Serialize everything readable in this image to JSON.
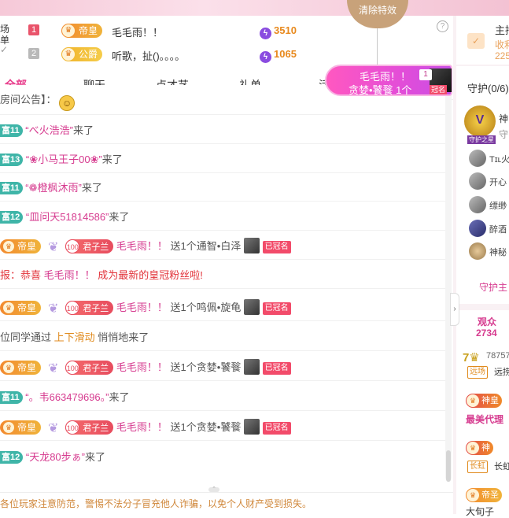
{
  "clear_effects_label": "清除特效",
  "ranking": {
    "cut_label_1": "场",
    "cut_label_2": "单",
    "cut_label_3": "✓",
    "rows": [
      {
        "rank": "1",
        "badge": "帝皇",
        "name": "毛毛雨！！",
        "coins": "3510"
      },
      {
        "rank": "2",
        "badge": "公爵",
        "name": "听歌，扯()。。。。",
        "coins": "1065"
      }
    ],
    "help_icon": "?"
  },
  "tabs": [
    "全部",
    "聊天",
    "点才艺",
    "礼单",
    "活"
  ],
  "banner": {
    "line1": "毛毛雨！！",
    "line2": "贪婪•饕餮 1个",
    "count": "1",
    "tag": "冠名"
  },
  "chat": {
    "m1": {
      "prefix": "房间公告】：",
      "emoji": "😁"
    },
    "m2": {
      "level": "富11",
      "name": "“べ火浩浩”",
      "suffix": "来了"
    },
    "m3": {
      "level": "富13",
      "name": "“❀小马王子00❀”",
      "suffix": "来了"
    },
    "m4": {
      "level": "富11",
      "name": "“❁橙枫沐雨”",
      "suffix": "来了"
    },
    "m5": {
      "level": "富12",
      "name": "“皿问天51814586”",
      "suffix": "来了"
    },
    "m6": {
      "badge": "帝皇",
      "fan_level": "100",
      "fan_name": "君子兰",
      "user": "毛毛雨！！",
      "gift": "送1个通智•白泽",
      "tag": "已冠名"
    },
    "m7": {
      "text_a": "报：恭喜 ",
      "user": "毛毛雨！！",
      "text_b": " 成为最新的皇冠粉丝啦!"
    },
    "m8": {
      "badge": "帝皇",
      "fan_level": "100",
      "fan_name": "君子兰",
      "user": "毛毛雨！！",
      "gift": "送1个鸣佩•旋龟",
      "tag": "已冠名"
    },
    "m9": {
      "text_a": "位同学通过 ",
      "highlight": "上下滑动",
      "text_b": " 悄悄地来了"
    },
    "m10": {
      "badge": "帝皇",
      "fan_level": "100",
      "fan_name": "君子兰",
      "user": "毛毛雨！！",
      "gift": "送1个贪婪•饕餮",
      "tag": "已冠名"
    },
    "m11": {
      "level": "富11",
      "name": "“。韦663479696。”",
      "suffix": "来了"
    },
    "m12": {
      "badge": "帝皇",
      "fan_level": "100",
      "fan_name": "君子兰",
      "user": "毛毛雨！！",
      "gift": "送1个贪婪•饕餮",
      "tag": "已冠名"
    },
    "m13": {
      "level": "富12",
      "name": "“天龙80步ぁ”",
      "suffix": "来了"
    }
  },
  "notice": "各位玩家注意防范，警惕不法分子冒充他人诈骗，以免个人财产受到损失。",
  "right": {
    "host_label": "主持",
    "host_sub1": "收利",
    "host_sub2": "225",
    "guard_tab": "守护",
    "guard_count": "(0/6)",
    "god_label": "神",
    "guard_sub": "守",
    "guard_badge": "守护之星",
    "members": [
      "Tɪʟ火",
      "开心",
      "缥缈",
      "醉酒",
      "神秘"
    ],
    "guard_link": "守护主",
    "audience_label": "观众",
    "audience_count": "2734",
    "v1_num": "78757",
    "v1_tag": "远场",
    "v1_name": "远捞",
    "v2_badge": "神皇",
    "v2_name": "最美代理",
    "v3_badge": "神",
    "v3_tag": "长虹",
    "v3_name": "长虹",
    "v4_badge": "帝圣",
    "v4_name": "大旬子"
  }
}
